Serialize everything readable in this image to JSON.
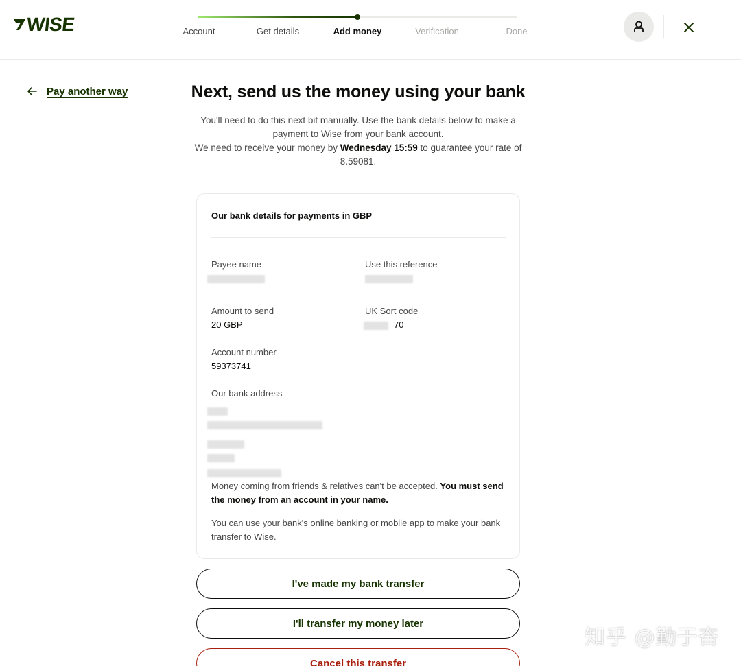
{
  "brand": {
    "name": "7WISE",
    "text": "WISE",
    "color": "#163300"
  },
  "stepper": {
    "steps": [
      {
        "label": "Account",
        "state": "done"
      },
      {
        "label": "Get details",
        "state": "done"
      },
      {
        "label": "Add money",
        "state": "active"
      },
      {
        "label": "Verification",
        "state": "future"
      },
      {
        "label": "Done",
        "state": "future"
      }
    ]
  },
  "header": {
    "profile_icon": "user-icon",
    "close_icon": "close-icon"
  },
  "back_link": {
    "label": "Pay another way",
    "icon": "arrow-left-icon"
  },
  "main": {
    "title": "Next, send us the money using your bank",
    "intro_line1": "You'll need to do this next bit manually. Use the bank details below to make a payment to Wise from your bank account.",
    "intro_line2_pre": "We need to receive your money by ",
    "intro_deadline": "Wednesday 15:59",
    "intro_line2_post": " to guarantee your rate of 8.59081."
  },
  "card": {
    "heading": "Our bank details for payments in GBP",
    "fields": {
      "payee_name": {
        "label": "Payee name",
        "value": ""
      },
      "reference": {
        "label": "Use this reference",
        "value": ""
      },
      "amount": {
        "label": "Amount to send",
        "value": "20 GBP"
      },
      "sort_code": {
        "label": "UK Sort code",
        "value": "70"
      },
      "account_number": {
        "label": "Account number",
        "value": "59373741"
      },
      "bank_address": {
        "label": "Our bank address",
        "value": ""
      }
    },
    "note1_pre": "Money coming from friends & relatives can't be accepted. ",
    "note1_bold": "You must send the money from an account in your name.",
    "note2": "You can use your bank's online banking or mobile app to make your bank transfer to Wise."
  },
  "buttons": {
    "made_transfer": "I've made my bank transfer",
    "transfer_later": "I'll transfer my money later",
    "cancel": "Cancel this transfer"
  },
  "watermark": "知乎 @勤于奋",
  "colors": {
    "accent": "#163300",
    "danger": "#a8200d",
    "progress": "#9fe870"
  }
}
